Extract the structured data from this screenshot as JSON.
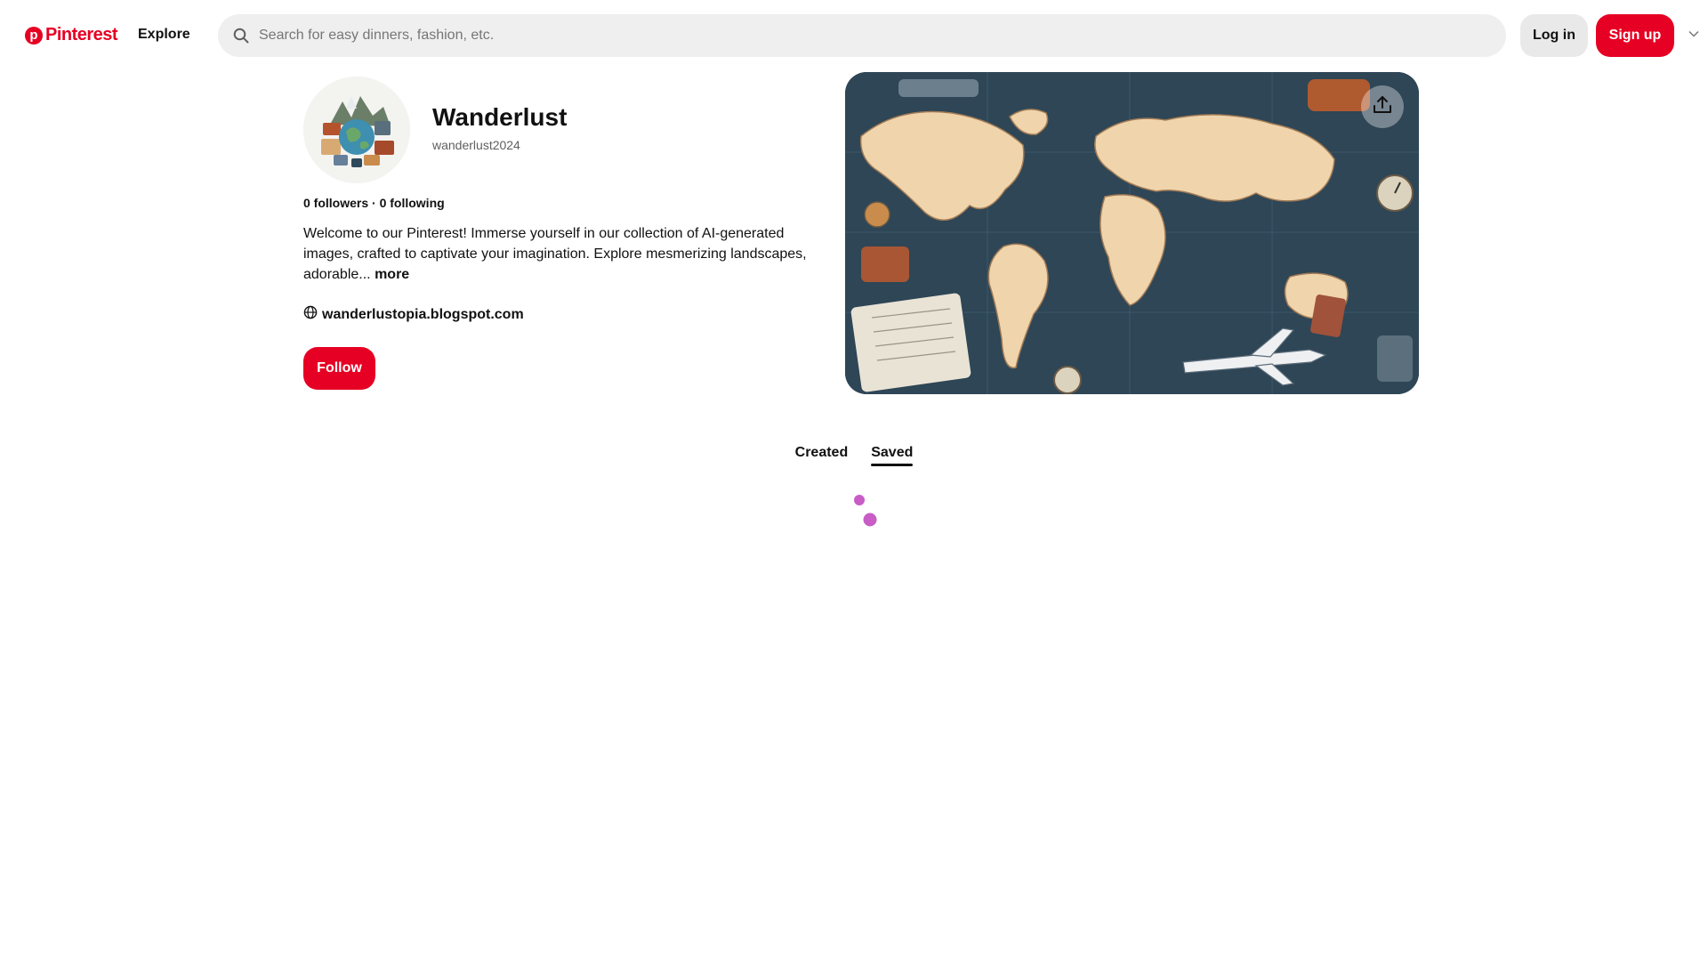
{
  "header": {
    "logo_text": "Pinterest",
    "nav_explore": "Explore",
    "search_placeholder": "Search for easy dinners, fashion, etc.",
    "login_label": "Log in",
    "signup_label": "Sign up",
    "icons": {
      "search": "search-icon",
      "chevron": "chevron-down-icon"
    }
  },
  "profile": {
    "name": "Wanderlust",
    "handle": "wanderlust2024",
    "stats": "0 followers · 0 following",
    "bio": "Welcome to our Pinterest! Immerse yourself in our collection of AI-generated images, crafted to captivate your imagination. Explore mesmerizing landscapes, adorable...",
    "bio_more": "more",
    "website": "wanderlustopia.blogspot.com",
    "follow_label": "Follow"
  },
  "tabs": [
    {
      "label": "Created",
      "active": false
    },
    {
      "label": "Saved",
      "active": true
    }
  ],
  "colors": {
    "brand": "#e60023",
    "search_bg": "#efefef",
    "login_bg": "#e9e9e9",
    "spinner": "#c85dc6"
  }
}
